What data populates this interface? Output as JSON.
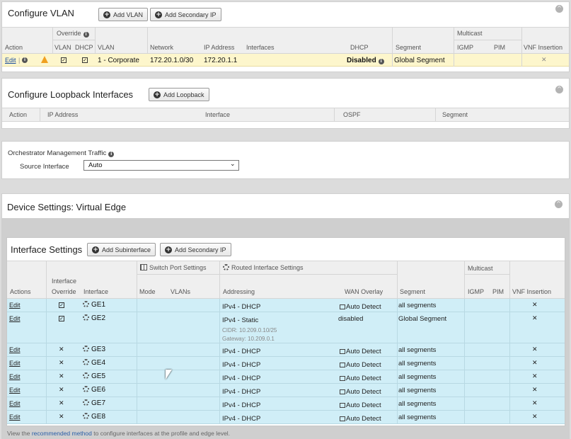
{
  "vlan": {
    "title": "Configure VLAN",
    "add_vlan": "Add VLAN",
    "add_secondary_ip": "Add Secondary IP",
    "headers": {
      "override": "Override",
      "multicast": "Multicast",
      "action": "Action",
      "vlan_cb": "VLAN",
      "dhcp_cb": "DHCP",
      "vlan": "VLAN",
      "network": "Network",
      "ip_address": "IP Address",
      "interfaces": "Interfaces",
      "dhcp": "DHCP",
      "segment": "Segment",
      "igmp": "IGMP",
      "pim": "PIM",
      "vnf": "VNF Insertion"
    },
    "row": {
      "edit": "Edit",
      "vlan": "1 - Corporate",
      "network": "172.20.1.0/30",
      "ip": "172.20.1.1",
      "dhcp": "Disabled",
      "segment": "Global Segment"
    }
  },
  "loopback": {
    "title": "Configure Loopback Interfaces",
    "add_loopback": "Add Loopback",
    "headers": {
      "action": "Action",
      "ip_address": "IP Address",
      "interface": "Interface",
      "ospf": "OSPF",
      "segment": "Segment"
    }
  },
  "mgmt": {
    "title": "Orchestrator Management Traffic",
    "source_label": "Source Interface",
    "source_value": "Auto"
  },
  "device": {
    "title": "Device Settings: Virtual Edge",
    "iface_title": "Interface Settings",
    "add_subinterface": "Add Subinterface",
    "add_secondary_ip": "Add Secondary IP",
    "headers": {
      "switch_port": "Switch Port Settings",
      "routed": "Routed Interface Settings",
      "multicast": "Multicast",
      "interface_override": "Interface",
      "override": "Override",
      "actions": "Actions",
      "interface": "Interface",
      "mode": "Mode",
      "vlans": "VLANs",
      "addressing": "Addressing",
      "wan_overlay": "WAN Overlay",
      "segment": "Segment",
      "igmp": "IGMP",
      "pim": "PIM",
      "vnf": "VNF Insertion"
    },
    "rows": [
      {
        "edit": "Edit",
        "iface": "GE1",
        "addressing": "IPv4 - DHCP",
        "wan": "Auto Detect",
        "segment": "all segments"
      },
      {
        "edit": "Edit",
        "iface": "GE2",
        "addressing": "IPv4 - Static",
        "cidr": "CIDR: 10.209.0.10/25",
        "gateway": "Gateway: 10.209.0.1",
        "wan": "disabled",
        "segment": "Global Segment"
      },
      {
        "edit": "Edit",
        "iface": "GE3",
        "addressing": "IPv4 - DHCP",
        "wan": "Auto Detect",
        "segment": "all segments"
      },
      {
        "edit": "Edit",
        "iface": "GE4",
        "addressing": "IPv4 - DHCP",
        "wan": "Auto Detect",
        "segment": "all segments"
      },
      {
        "edit": "Edit",
        "iface": "GE5",
        "addressing": "IPv4 - DHCP",
        "wan": "Auto Detect",
        "segment": "all segments"
      },
      {
        "edit": "Edit",
        "iface": "GE6",
        "addressing": "IPv4 - DHCP",
        "wan": "Auto Detect",
        "segment": "all segments"
      },
      {
        "edit": "Edit",
        "iface": "GE7",
        "addressing": "IPv4 - DHCP",
        "wan": "Auto Detect",
        "segment": "all segments"
      },
      {
        "edit": "Edit",
        "iface": "GE8",
        "addressing": "IPv4 - DHCP",
        "wan": "Auto Detect",
        "segment": "all segments"
      }
    ],
    "footer_pre": "View the",
    "footer_link": "recommended method",
    "footer_post": "to configure interfaces at the profile and edge level."
  },
  "icons": {
    "collapse": "chevron-up-circle-icon",
    "add": "plus-circle-icon",
    "info": "info-icon",
    "warning": "warning-icon",
    "check": "checkbox-checked-icon",
    "x": "x-icon",
    "gear": "interface-gear-icon"
  },
  "colors": {
    "highlight_row": "#fdf6cc",
    "interface_row": "#d0eef7",
    "warning": "#f0a020"
  }
}
